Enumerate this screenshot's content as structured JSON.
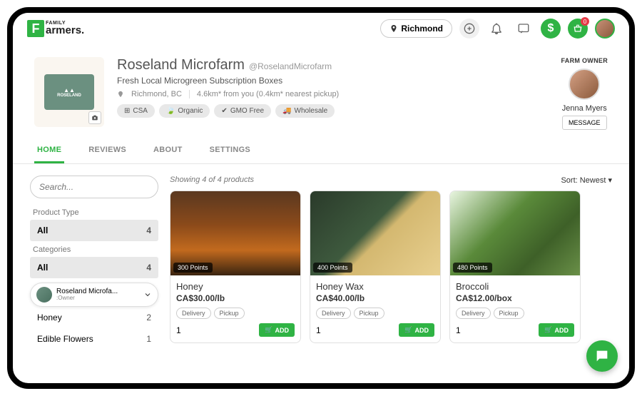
{
  "brand": {
    "letter": "F",
    "top": "FAMILY",
    "bottom": "armers."
  },
  "header": {
    "location": "Richmond",
    "cart_badge": "0"
  },
  "profile": {
    "name": "Roseland Microfarm",
    "handle": "@RoselandMicrofarm",
    "tagline": "Fresh Local Microgreen Subscription Boxes",
    "location": "Richmond, BC",
    "distance": "4.6km* from you (0.4km* nearest pickup)",
    "emblem_label": "ROSELAND",
    "tags": [
      "CSA",
      "Organic",
      "GMO Free",
      "Wholesale"
    ]
  },
  "owner": {
    "label": "FARM OWNER",
    "name": "Jenna Myers",
    "button": "MESSAGE"
  },
  "tabs": [
    "HOME",
    "REVIEWS",
    "ABOUT",
    "SETTINGS"
  ],
  "search": {
    "placeholder": "Search..."
  },
  "filters": {
    "type_label": "Product Type",
    "type_all": "All",
    "type_all_count": "4",
    "cat_label": "Categories",
    "cat_all": "All",
    "cat_all_count": "4",
    "honey": "Honey",
    "honey_count": "2",
    "flowers": "Edible Flowers",
    "flowers_count": "1"
  },
  "switcher": {
    "name": "Roseland Microfa...",
    "role": ":Owner"
  },
  "listing": {
    "count_text": "Showing 4 of 4 products",
    "sort_label": "Sort: Newest",
    "delivery": "Delivery",
    "pickup": "Pickup",
    "add": "ADD",
    "qty": "1"
  },
  "products": [
    {
      "points": "300 Points",
      "name": "Honey",
      "price": "CA$30.00/lb"
    },
    {
      "points": "400 Points",
      "name": "Honey Wax",
      "price": "CA$40.00/lb"
    },
    {
      "points": "480 Points",
      "name": "Broccoli",
      "price": "CA$12.00/box"
    }
  ]
}
